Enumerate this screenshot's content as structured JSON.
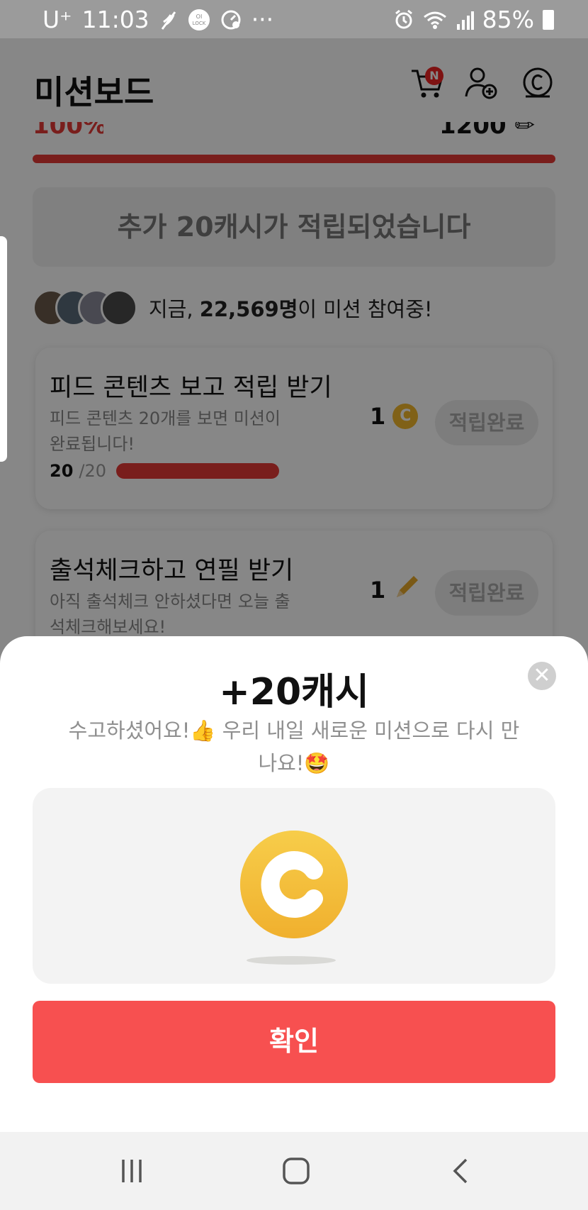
{
  "status_bar": {
    "carrier": "U⁺",
    "time": "11:03",
    "more": "···",
    "battery": "85%"
  },
  "header": {
    "title": "미션보드",
    "cart_badge": "N"
  },
  "banner": {
    "text": "추가 20캐시가 적립되었습니다"
  },
  "participants": {
    "prefix": "지금, ",
    "count": "22,569명",
    "suffix": "이 미션 참여중!"
  },
  "missions": [
    {
      "title": "피드 콘텐츠 보고 적립 받기",
      "description": "피드 콘텐츠 20개를 보면 미션이 완료됩니다!",
      "reward": "1",
      "reward_icon": "coin-icon",
      "button": "적립완료",
      "progress_done": "20",
      "progress_total": "/20",
      "progress": 1.0
    },
    {
      "title": "출석체크하고 연필 받기",
      "description": "아직 출석체크 안하셨다면 오늘 출석체크해보세요!",
      "reward": "1",
      "reward_icon": "pencil-icon",
      "button": "적립완료"
    }
  ],
  "sheet": {
    "title": "+20캐시",
    "message": "수고하셨어요!👍 우리 내일 새로운 미션으로 다시 만나요!🤩",
    "confirm": "확인",
    "close_icon": "close-icon",
    "coin_icon": "coin-icon"
  },
  "colors": {
    "accent": "#f75050",
    "progress": "#e53935",
    "coin": "#f4bf3a"
  }
}
